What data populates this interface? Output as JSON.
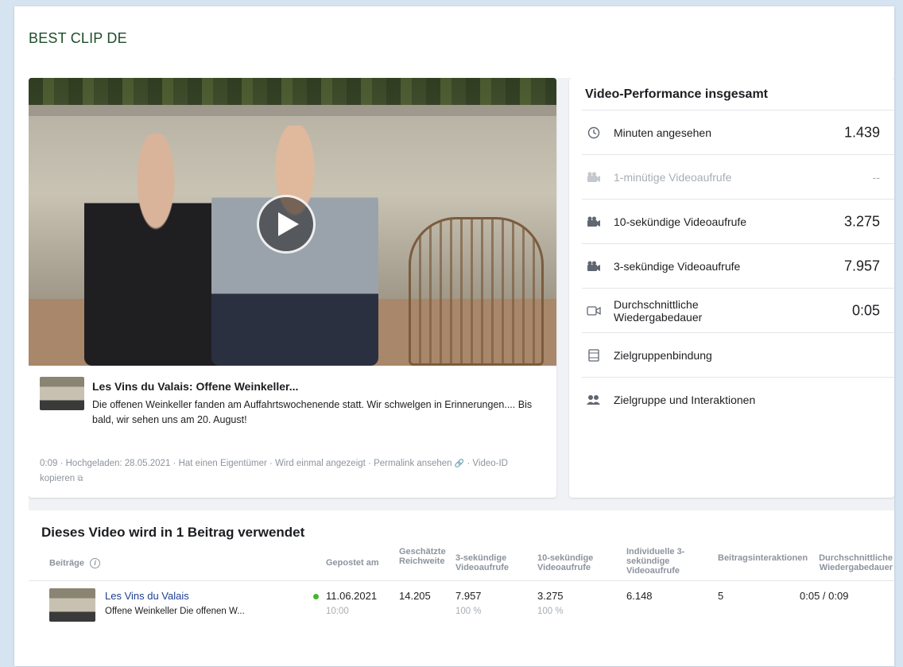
{
  "brand": {
    "title": "BEST CLIP DE"
  },
  "video": {
    "title": "Les Vins du Valais: Offene Weinkeller...",
    "description": "Die offenen Weinkeller fanden am Auffahrtswochenende statt. Wir schwelgen in Erinnerungen.... Bis bald, wir sehen uns am 20. August!",
    "meta": {
      "duration": "0:09",
      "uploaded": "Hochgeladen: 28.05.2021",
      "owner": "Hat einen Eigentümer",
      "shown": "Wird einmal angezeigt",
      "permalink": "Permalink ansehen",
      "copy_id": "Video-ID kopieren"
    }
  },
  "performance": {
    "title": "Video-Performance insgesamt",
    "rows": [
      {
        "icon": "clock-icon",
        "label": "Minuten angesehen",
        "value": "1.439"
      },
      {
        "icon": "video-views-icon",
        "label": "1-minütige Videoaufrufe",
        "value": "--"
      },
      {
        "icon": "video-views-icon",
        "label": "10-sekündige Videoaufrufe",
        "value": "3.275"
      },
      {
        "icon": "video-views-icon",
        "label": "3-sekündige Videoaufrufe",
        "value": "7.957"
      },
      {
        "icon": "video-camera-icon",
        "label": "Durchschnittliche Wiedergabedauer",
        "value": "0:05"
      },
      {
        "icon": "film-icon",
        "label": "Zielgruppenbindung",
        "value": ""
      },
      {
        "icon": "people-icon",
        "label": "Zielgruppe und Interaktionen",
        "value": ""
      }
    ]
  },
  "posts": {
    "title": "Dieses Video wird in 1 Beitrag verwendet",
    "headers": {
      "posts": "Beiträge",
      "posted": "Gepostet am",
      "reach": "Geschätzte Reichweite",
      "views3": "3-sekündige Videoaufrufe",
      "views10": "10-sekündige Videoaufrufe",
      "unique3": "Individuelle 3-sekündige Videoaufrufe",
      "interactions": "Beitragsinteraktionen",
      "avgwatch": "Durchschnittliche Wiedergabedauer"
    },
    "row": {
      "title": "Les Vins du Valais",
      "subtitle": "Offene Weinkeller Die offenen W...",
      "date": "11.06.2021",
      "time": "10:00",
      "reach": "14.205",
      "views3": "7.957",
      "views3_pct": "100 %",
      "views10": "3.275",
      "views10_pct": "100 %",
      "unique3": "6.148",
      "interactions": "5",
      "avgwatch": "0:05 / 0:09"
    }
  },
  "colors": {
    "background": "#d6e3f1",
    "brand_text": "#1e4d2b",
    "link": "#1d3f8f",
    "status_dot": "#42b72a"
  }
}
